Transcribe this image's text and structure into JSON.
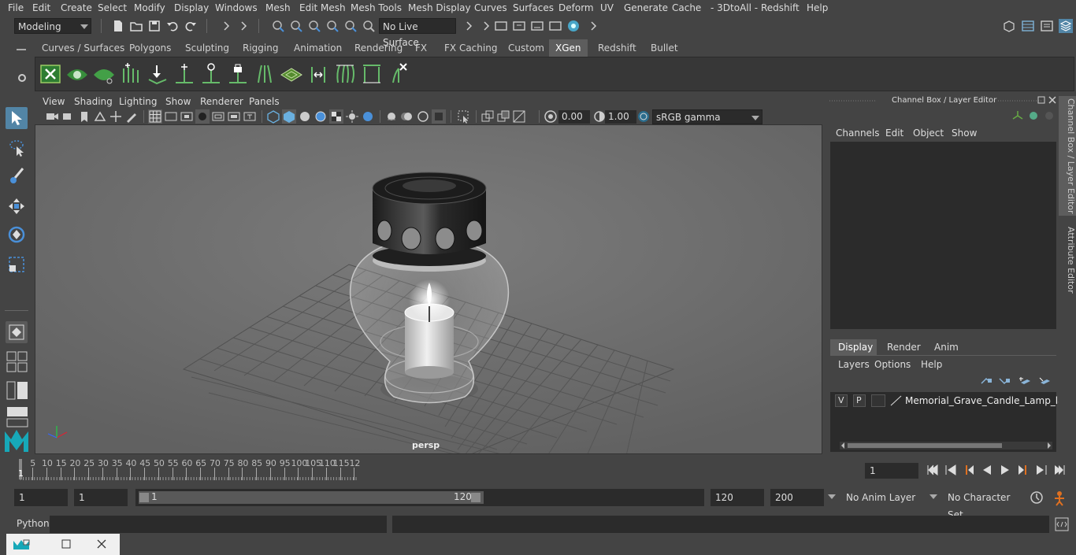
{
  "menubar": [
    "File",
    "Edit",
    "Create",
    "Select",
    "Modify",
    "Display",
    "Windows",
    "Mesh",
    "Edit Mesh",
    "Mesh Tools",
    "Mesh Display",
    "Curves",
    "Surfaces",
    "Deform",
    "UV",
    "Generate",
    "Cache",
    "- 3DtoAll -",
    "Redshift",
    "Help"
  ],
  "status": {
    "mode": "Modeling",
    "live_surface": "No Live Surface"
  },
  "shelf_tabs": [
    "Curves / Surfaces",
    "Polygons",
    "Sculpting",
    "Rigging",
    "Animation",
    "Rendering",
    "FX",
    "FX Caching",
    "Custom",
    "XGen",
    "Redshift",
    "Bullet"
  ],
  "shelf_active": "XGen",
  "viewport": {
    "menu": [
      "View",
      "Shading",
      "Lighting",
      "Show",
      "Renderer",
      "Panels"
    ],
    "exposure": "0.00",
    "gamma": "1.00",
    "colorspace": "sRGB gamma",
    "camera_label": "persp"
  },
  "channel_box": {
    "title": "Channel Box / Layer Editor",
    "menu": [
      "Channels",
      "Edit",
      "Object",
      "Show"
    ],
    "layer_tabs": [
      "Display",
      "Render",
      "Anim"
    ],
    "active_tab": "Display",
    "layer_menu": [
      "Layers",
      "Options",
      "Help"
    ],
    "layer": {
      "v": "V",
      "p": "P",
      "name": "Memorial_Grave_Candle_Lamp_layer"
    }
  },
  "side_tabs": [
    "Channel Box / Layer Editor",
    "Attribute Editor"
  ],
  "timeline": {
    "ticks": [
      "5",
      "10",
      "15",
      "20",
      "25",
      "30",
      "35",
      "40",
      "45",
      "50",
      "55",
      "60",
      "65",
      "70",
      "75",
      "80",
      "85",
      "90",
      "95",
      "100",
      "105",
      "110",
      "115",
      "12"
    ],
    "current_frame_marker": "1",
    "current_frame": "1"
  },
  "range": {
    "start": "1",
    "playback_start": "1",
    "slider_start": "1",
    "slider_end": "120",
    "playback_end": "120",
    "end": "200",
    "anim_layer": "No Anim Layer",
    "character_set": "No Character Set"
  },
  "command": {
    "label": "Python"
  },
  "colors": {
    "accent": "#5285a6",
    "active_tab": "#5d5d5d",
    "shelf_green": "#4caf50",
    "bg": "#444444"
  }
}
